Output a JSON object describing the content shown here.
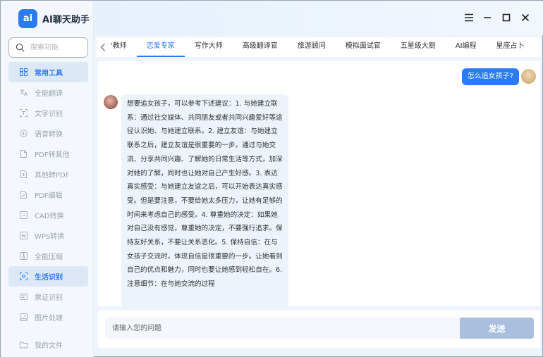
{
  "app": {
    "logo_mark": "ai",
    "title": "AI聊天助手"
  },
  "search": {
    "placeholder": "搜索功能"
  },
  "nav": {
    "items": [
      {
        "label": "常用工具",
        "icon": "grid-icon",
        "active": true
      },
      {
        "label": "全能翻译",
        "icon": "translate-icon"
      },
      {
        "label": "文字识别",
        "icon": "text-recognition-icon"
      },
      {
        "label": "语音转换",
        "icon": "voice-icon"
      },
      {
        "label": "PDF转其他",
        "icon": "pdf-convert-icon"
      },
      {
        "label": "其他转PDF",
        "icon": "to-pdf-icon"
      },
      {
        "label": "PDF编辑",
        "icon": "pdf-edit-icon"
      },
      {
        "label": "CAD转换",
        "icon": "cad-icon"
      },
      {
        "label": "WPS转换",
        "icon": "wps-icon"
      },
      {
        "label": "全能压缩",
        "icon": "compress-icon"
      },
      {
        "label": "生活识别",
        "icon": "scan-icon",
        "active": true
      },
      {
        "label": "票证识别",
        "icon": "ticket-icon"
      },
      {
        "label": "图片处理",
        "icon": "image-icon"
      }
    ],
    "bottom": {
      "label": "我的文件",
      "icon": "folder-icon"
    }
  },
  "tabs": {
    "back_icon": "chevron-left-icon",
    "items": [
      "'教师",
      "恋爱专家",
      "写作大师",
      "高级翻译官",
      "旅游顾问",
      "模拟面试官",
      "五星级大厨",
      "AI编程",
      "星座占卜"
    ],
    "active_index": 1
  },
  "chat": {
    "user_message": "怎么追女孩子?",
    "bot_message": "想要追女孩子，可以参考下述建议：1. 与她建立联系：通过社交媒体、共同朋友或者共同兴趣爱好等途径认识她、与她建立联系。2. 建立友谊：与她建立联系之后，建立友谊是很重要的一步。通过与她交流、分享共同兴趣、了解她的日常生活等方式，加深对她的了解，同时也让她对自己产生好感。3. 表达真实感受：与她建立友谊之后，可以开始表达真实感受。但是要注意，不要给她太多压力，让她有足够的时间来考虑自己的感受。4. 尊重她的决定：如果她对自己没有感觉，尊重她的决定，不要强行追求。保持友好关系，不要让关系恶化。5. 保持自信：在与女孩子交流时，体现自信是很重要的一步。让她看到自己的优点和魅力，同时也要让她感到轻松自在。6. 注意细节：在与她交流的过程"
  },
  "input": {
    "placeholder": "请输入您的问题",
    "send_label": "发送"
  },
  "colors": {
    "accent": "#2b7cf0",
    "send_button": "#a9bfdd"
  }
}
